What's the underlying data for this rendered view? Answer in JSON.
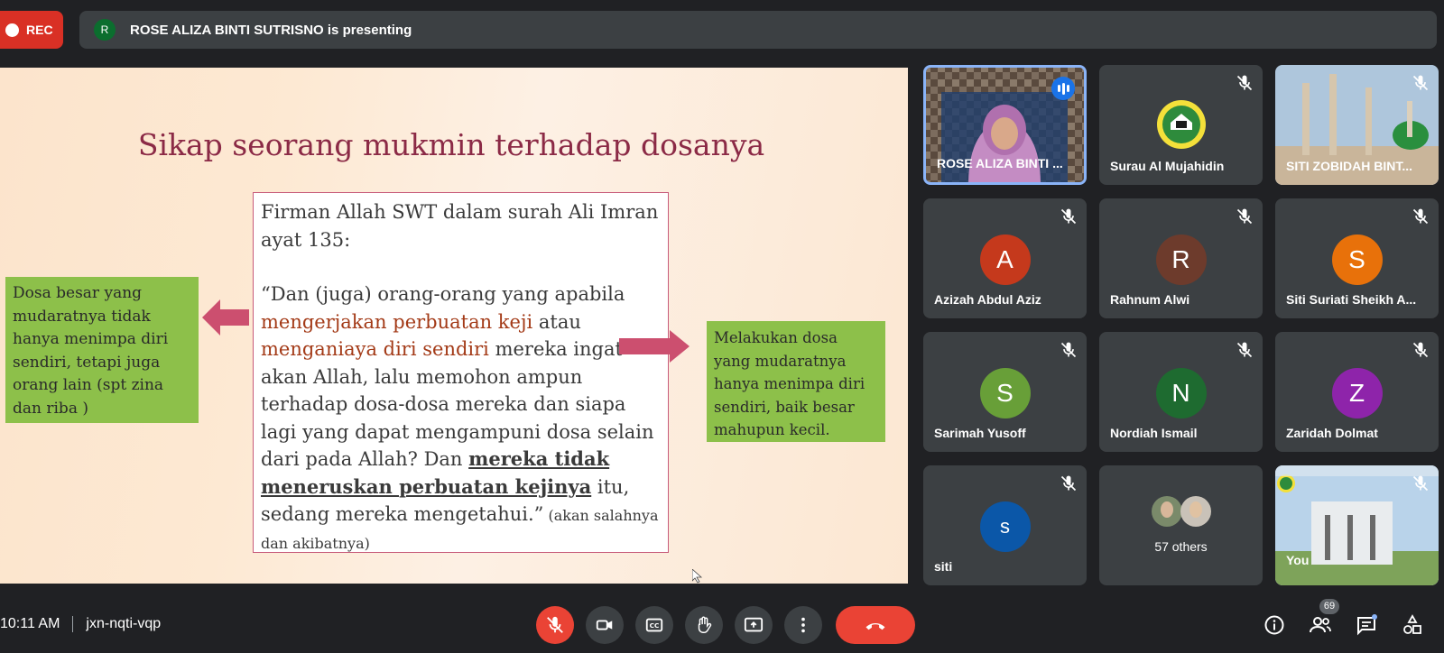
{
  "recording": {
    "label": "REC"
  },
  "presenting_bar": {
    "avatar_initial": "R",
    "text": "ROSE ALIZA BINTI SUTRISNO is presenting",
    "avatar_color": "#0b6e2e"
  },
  "slide": {
    "title": "Sikap seorang mukmin terhadap dosanya",
    "center_box": {
      "line1": "Firman Allah SWT dalam surah Ali Imran ayat 135:",
      "quote_start": "“Dan (juga) orang-orang yang apabila ",
      "red1": "mengerjakan perbuatan keji",
      "mid1": " atau ",
      "red2": "menganiaya diri sendiri",
      "mid2": " mereka ingat akan Allah, lalu memohon ampun terhadap dosa-dosa mereka dan siapa lagi yang dapat mengampuni dosa selain dari pada Allah? Dan ",
      "bold": "mereka tidak meneruskan perbuatan kejinya",
      "end": " itu, sedang mereka mengetahui.”",
      "small": " (akan salahnya dan akibatnya)"
    },
    "left_box": "Dosa besar yang mudaratnya tidak hanya menimpa diri sendiri, tetapi juga orang lain (spt zina dan riba )",
    "right_box": "Melakukan dosa yang mudaratnya hanya menimpa diri sendiri, baik besar mahupun kecil."
  },
  "participants": [
    {
      "name": "ROSE ALIZA BINTI ...",
      "type": "video",
      "active": true
    },
    {
      "name": "Surau Al Mujahidin",
      "type": "logo"
    },
    {
      "name": "SITI ZOBIDAH BINT...",
      "type": "image"
    },
    {
      "name": "Azizah Abdul Aziz",
      "initial": "A",
      "color": "#c5391c"
    },
    {
      "name": "Rahnum Alwi",
      "initial": "R",
      "color": "#6d3b2c"
    },
    {
      "name": "Siti Suriati Sheikh A...",
      "initial": "S",
      "color": "#e8710a"
    },
    {
      "name": "Sarimah Yusoff",
      "initial": "S",
      "color": "#689f38"
    },
    {
      "name": "Nordiah Ismail",
      "initial": "N",
      "color": "#1e6b30"
    },
    {
      "name": "Zaridah Dolmat",
      "initial": "Z",
      "color": "#8e24aa"
    },
    {
      "name": "siti",
      "initial": "s",
      "color": "#0b57a8"
    },
    {
      "name": "57 others",
      "type": "others"
    },
    {
      "name": "You",
      "type": "self"
    }
  ],
  "bottom": {
    "time": "10:11 AM",
    "meeting_code": "jxn-nqti-vqp",
    "participants_count": "69"
  },
  "icons": {
    "mic_off": "mic-off-icon",
    "camera": "camera-icon",
    "captions": "captions-icon",
    "hand": "raise-hand-icon",
    "present": "present-screen-icon",
    "more": "more-options-icon",
    "end": "end-call-icon",
    "info": "info-icon",
    "people": "people-icon",
    "chat": "chat-icon",
    "activities": "activities-icon"
  },
  "colors": {
    "accent_red": "#ea4335",
    "tile_bg": "#3c4043",
    "page_bg": "#202124",
    "active_border": "#8ab4f8"
  }
}
